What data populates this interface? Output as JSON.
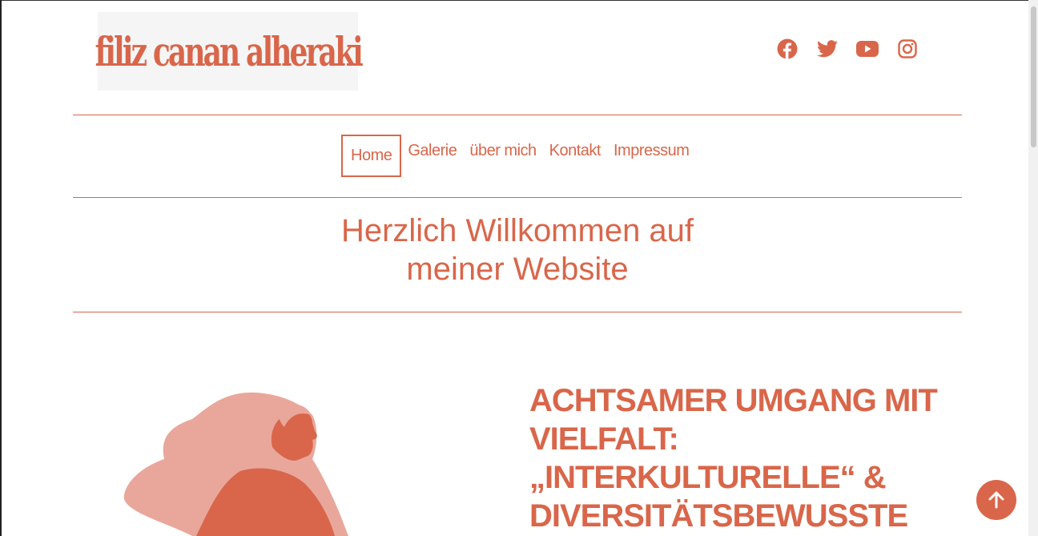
{
  "header": {
    "logo_text": "filiz canan alheraki"
  },
  "social": {
    "items": [
      {
        "name": "facebook-icon"
      },
      {
        "name": "twitter-icon"
      },
      {
        "name": "youtube-icon"
      },
      {
        "name": "instagram-icon"
      }
    ]
  },
  "nav": {
    "items": [
      {
        "label": "Home"
      },
      {
        "label": "Galerie"
      },
      {
        "label": "über mich"
      },
      {
        "label": "Kontakt"
      },
      {
        "label": "Impressum"
      }
    ]
  },
  "welcome": {
    "line1": "Herzlich Willkommen auf",
    "line2": "meiner Website"
  },
  "hero": {
    "headline_line1": "ACHTSAMER UMGANG MIT",
    "headline_line2": "VIELFALT:",
    "headline_line3": "„INTERKULTURELLE“ &",
    "headline_line4": "DIVERSITÄTSBEWUSSTE"
  },
  "colors": {
    "accent": "#d9664a",
    "illustration_pink": "#e9a79c",
    "logo_bg": "#f5f5f5"
  },
  "icons": {
    "back_to_top": "arrow-up-icon"
  }
}
